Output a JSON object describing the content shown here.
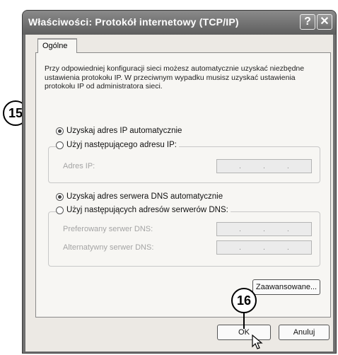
{
  "window": {
    "title": "Właściwości: Protokół internetowy (TCP/IP)",
    "help_label": "?",
    "close_label": "✕"
  },
  "tabs": [
    {
      "label": "Ogólne"
    }
  ],
  "description": "Przy odpowiedniej konfiguracji sieci możesz automatycznie uzyskać niezbędne ustawienia protokołu IP. W przeciwnym wypadku musisz uzyskać ustawienia protokołu IP od administratora sieci.",
  "ip": {
    "auto_label": "Uzyskaj adres IP automatycznie",
    "auto_selected": true,
    "manual_label": "Użyj następującego adresu IP:",
    "address_label": "Adres IP:"
  },
  "dns": {
    "auto_label": "Uzyskaj adres serwera DNS automatycznie",
    "auto_selected": true,
    "manual_label": "Użyj następujących adresów serwerów DNS:",
    "preferred_label": "Preferowany serwer DNS:",
    "alternate_label": "Alternatywny serwer DNS:"
  },
  "buttons": {
    "advanced": "Zaawansowane...",
    "ok": "OK",
    "cancel": "Anuluj"
  },
  "callouts": {
    "first": "15",
    "second": "16"
  }
}
